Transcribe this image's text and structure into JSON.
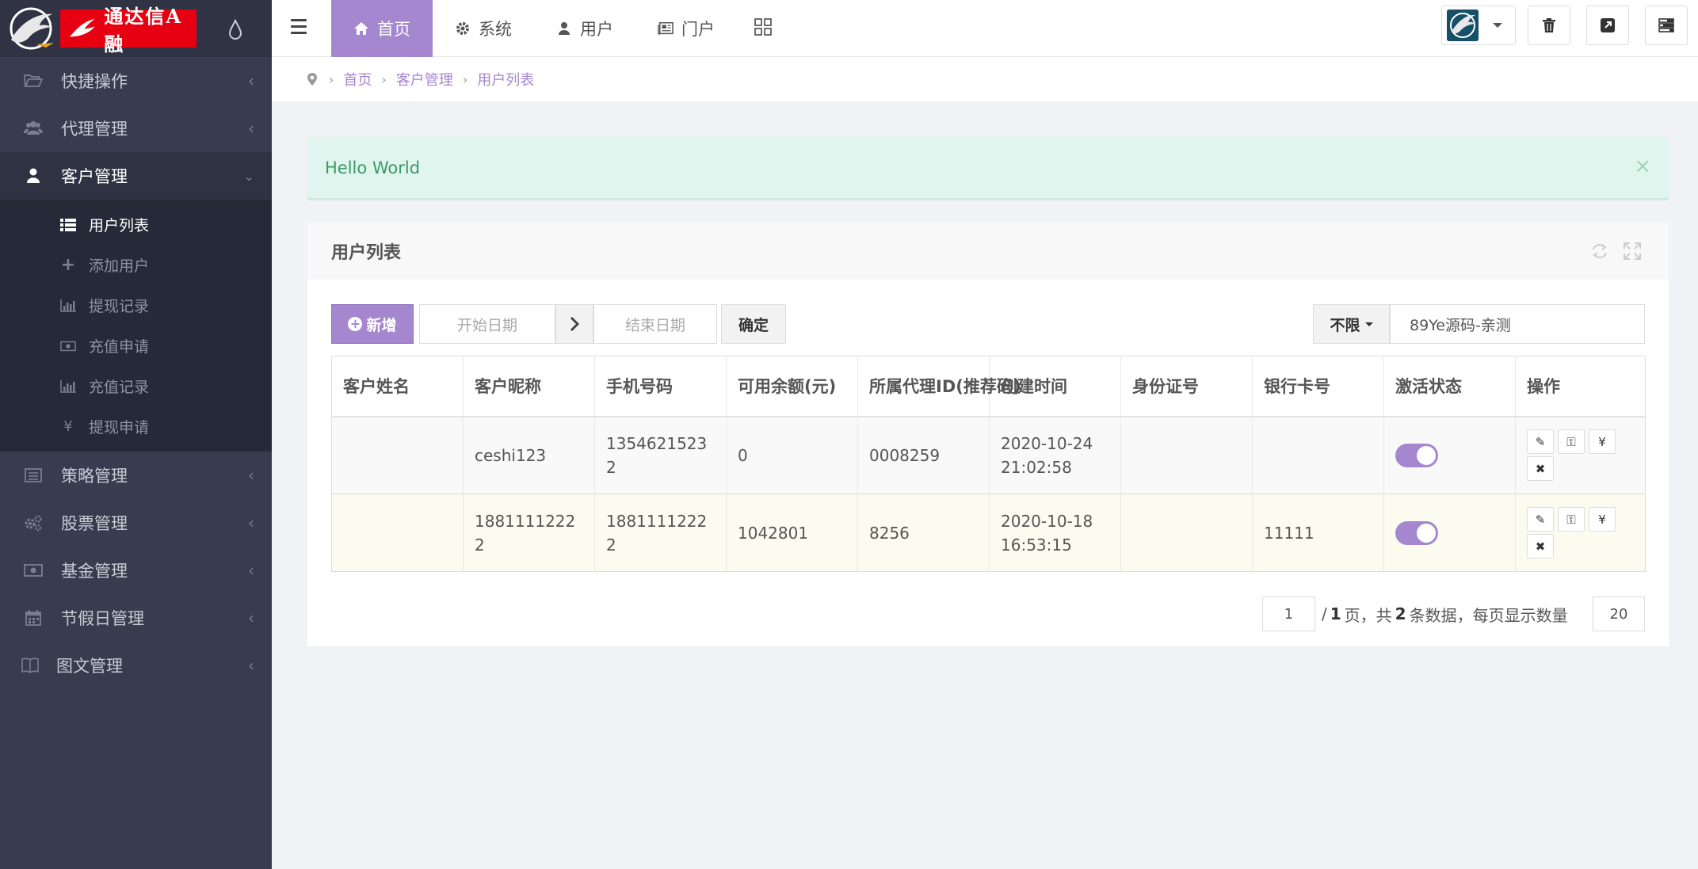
{
  "brand": {
    "logo_text": "通达信A融"
  },
  "sidebar": {
    "items": [
      {
        "label": "快捷操作",
        "icon": "folder-open-icon"
      },
      {
        "label": "代理管理",
        "icon": "users-icon"
      },
      {
        "label": "客户管理",
        "icon": "user-icon",
        "expanded": true
      },
      {
        "label": "策略管理",
        "icon": "list-alt-icon"
      },
      {
        "label": "股票管理",
        "icon": "cogs-icon"
      },
      {
        "label": "基金管理",
        "icon": "money-icon"
      },
      {
        "label": "节假日管理",
        "icon": "calendar-icon"
      },
      {
        "label": "图文管理",
        "icon": "book-icon"
      }
    ],
    "submenu": [
      {
        "label": "用户列表",
        "icon": "list-icon",
        "active": true
      },
      {
        "label": "添加用户",
        "icon": "plus-icon"
      },
      {
        "label": "提现记录",
        "icon": "bar-chart-icon"
      },
      {
        "label": "充值申请",
        "icon": "money-icon"
      },
      {
        "label": "充值记录",
        "icon": "bar-chart-icon"
      },
      {
        "label": "提现申请",
        "icon": "yen-icon",
        "glyph": "¥"
      }
    ]
  },
  "topnav": {
    "tabs": [
      {
        "label": "首页",
        "icon": "home-icon"
      },
      {
        "label": "系统",
        "icon": "gear-icon"
      },
      {
        "label": "用户",
        "icon": "user-icon"
      },
      {
        "label": "门户",
        "icon": "newspaper-icon"
      }
    ]
  },
  "breadcrumb": {
    "items": [
      "首页",
      "客户管理",
      "用户列表"
    ]
  },
  "alert": {
    "message": "Hello World",
    "close": "×"
  },
  "panel": {
    "title": "用户列表",
    "new_button": "新增",
    "start_date_placeholder": "开始日期",
    "end_date_placeholder": "结束日期",
    "confirm_button": "确定",
    "filter_select": "不限",
    "search_value": "89Ye源码-亲测"
  },
  "table": {
    "columns": [
      "客户姓名",
      "客户昵称",
      "手机号码",
      "可用余额(元)",
      "所属代理ID(推荐码)",
      "创建时间",
      "身份证号",
      "银行卡号",
      "激活状态",
      "操作"
    ],
    "rows": [
      {
        "name": "",
        "nickname": "ceshi123",
        "phone": "13546215232",
        "balance": "0",
        "agent_id": "0008259",
        "created": "2020-10-24 21:02:58",
        "id_card": "",
        "bank_card": "",
        "active": true
      },
      {
        "name": "",
        "nickname": "18811112222",
        "phone": "18811112222",
        "balance": "1042801",
        "agent_id": "8256",
        "created": "2020-10-18 16:53:15",
        "id_card": "",
        "bank_card": "11111",
        "active": true
      }
    ],
    "ops_glyphs": {
      "edit": "✎",
      "key": "⚿",
      "yen": "¥",
      "delete": "✖"
    }
  },
  "pagination": {
    "current_page": "1",
    "slash": "/",
    "total_pages": "1",
    "page_suffix": "页，共",
    "total_records": "2",
    "records_suffix": "条数据，每页显示数量",
    "page_size": "20"
  },
  "colors": {
    "accent": "#a487cf",
    "sidebar_bg": "#383c4e",
    "logo_red": "#e60012",
    "alert_bg": "#dff5ed"
  }
}
